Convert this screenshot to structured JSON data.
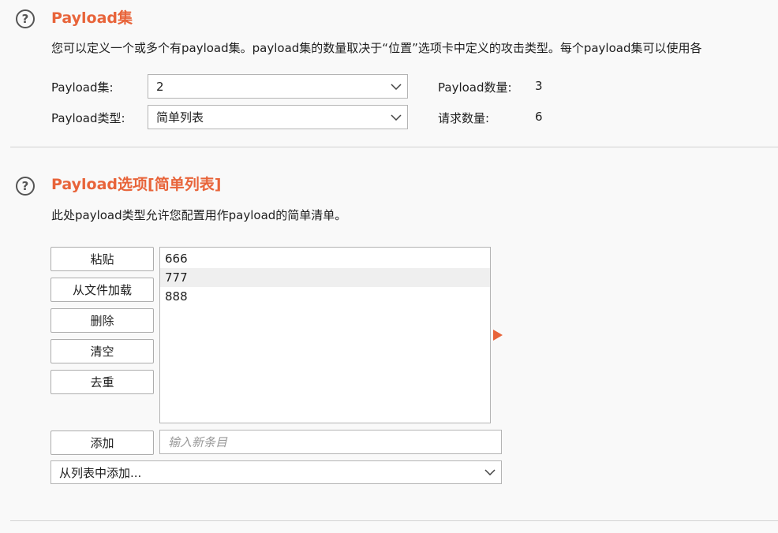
{
  "payload_sets": {
    "heading": "Payload集",
    "description": "您可以定义一个或多个有payload集。payload集的数量取决于“位置”选项卡中定义的攻击类型。每个payload集可以使用各",
    "set_label": "Payload集:",
    "set_value": "2",
    "type_label": "Payload类型:",
    "type_value": "简单列表",
    "count_label": "Payload数量:",
    "count_value": "3",
    "request_label": "请求数量:",
    "request_value": "6"
  },
  "payload_options": {
    "heading": "Payload选项[简单列表]",
    "description": "此处payload类型允许您配置用作payload的简单清单。",
    "buttons": {
      "paste": "粘贴",
      "load": "从文件加载",
      "remove": "删除",
      "clear": "清空",
      "dedupe": "去重",
      "add": "添加"
    },
    "items": [
      "666",
      "777",
      "888"
    ],
    "new_item_placeholder": "输入新条目",
    "add_from_list": "从列表中添加..."
  },
  "colors": {
    "accent": "#e8643a",
    "selected_row": "#efefef"
  }
}
